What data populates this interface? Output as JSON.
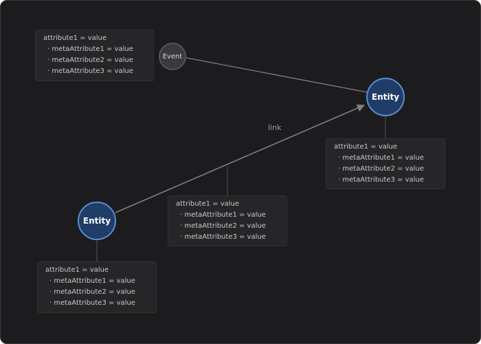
{
  "colors": {
    "background": "#1c1c1e",
    "entity_fill": "#1f3d68",
    "entity_border": "#5b8ed1",
    "event_fill": "#3a3a3c",
    "edge": "#7f7f84",
    "card": "#262628"
  },
  "nodes": {
    "event": {
      "label": "Event"
    },
    "entity_top": {
      "label": "Entity"
    },
    "entity_bottom": {
      "label": "Entity"
    }
  },
  "edge_link": {
    "label": "link"
  },
  "cards": {
    "event": {
      "attribute": "attribute1 = value",
      "meta": [
        "metaAttribute1 = value",
        "metaAttribute2 = value",
        "metaAttribute3 = value"
      ]
    },
    "entity_top": {
      "attribute": "attribute1 = value",
      "meta": [
        "metaAttribute1 = value",
        "metaAttribute2 = value",
        "metaAttribute3 = value"
      ]
    },
    "link": {
      "attribute": "attribute1 = value",
      "meta": [
        "metaAttribute1 = value",
        "metaAttribute2 = value",
        "metaAttribute3 = value"
      ]
    },
    "entity_bottom": {
      "attribute": "attribute1 = value",
      "meta": [
        "metaAttribute1 = value",
        "metaAttribute2 = value",
        "metaAttribute3 = value"
      ]
    }
  }
}
